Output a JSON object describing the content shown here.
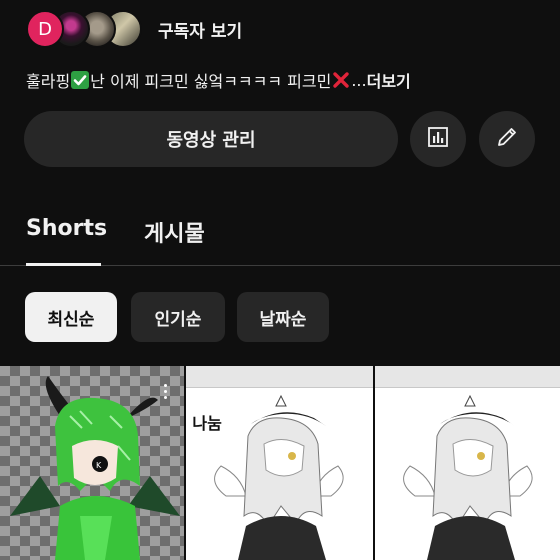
{
  "subscribers": {
    "first_avatar_letter": "D",
    "link_label": "구독자 보기"
  },
  "description": {
    "text_part1": "훌라핑",
    "text_part2": "난 이제 피크민 싫엌ㅋㅋㅋㅋ 피크민",
    "text_part3": " ...",
    "more_label": "더보기",
    "check_color": "#2ea043",
    "cross_color": "#e0243a"
  },
  "actions": {
    "manage_label": "동영상 관리",
    "stats_icon": "bar-chart-icon",
    "edit_icon": "pencil-icon"
  },
  "tabs": [
    {
      "label": "Shorts",
      "selected": true
    },
    {
      "label": "게시물",
      "selected": false
    }
  ],
  "sort_chips": [
    {
      "label": "최신순",
      "selected": true
    },
    {
      "label": "인기순",
      "selected": false
    },
    {
      "label": "날짜순",
      "selected": false
    }
  ],
  "shorts": [
    {
      "thumbnail": "green-dragon-character"
    },
    {
      "thumbnail": "maid-character-drawing",
      "overlay_text": "나눔"
    },
    {
      "thumbnail": "maid-character-drawing"
    }
  ],
  "colors": {
    "background": "#0f0f0f",
    "surface": "#272727",
    "text": "#f1f1f1"
  }
}
